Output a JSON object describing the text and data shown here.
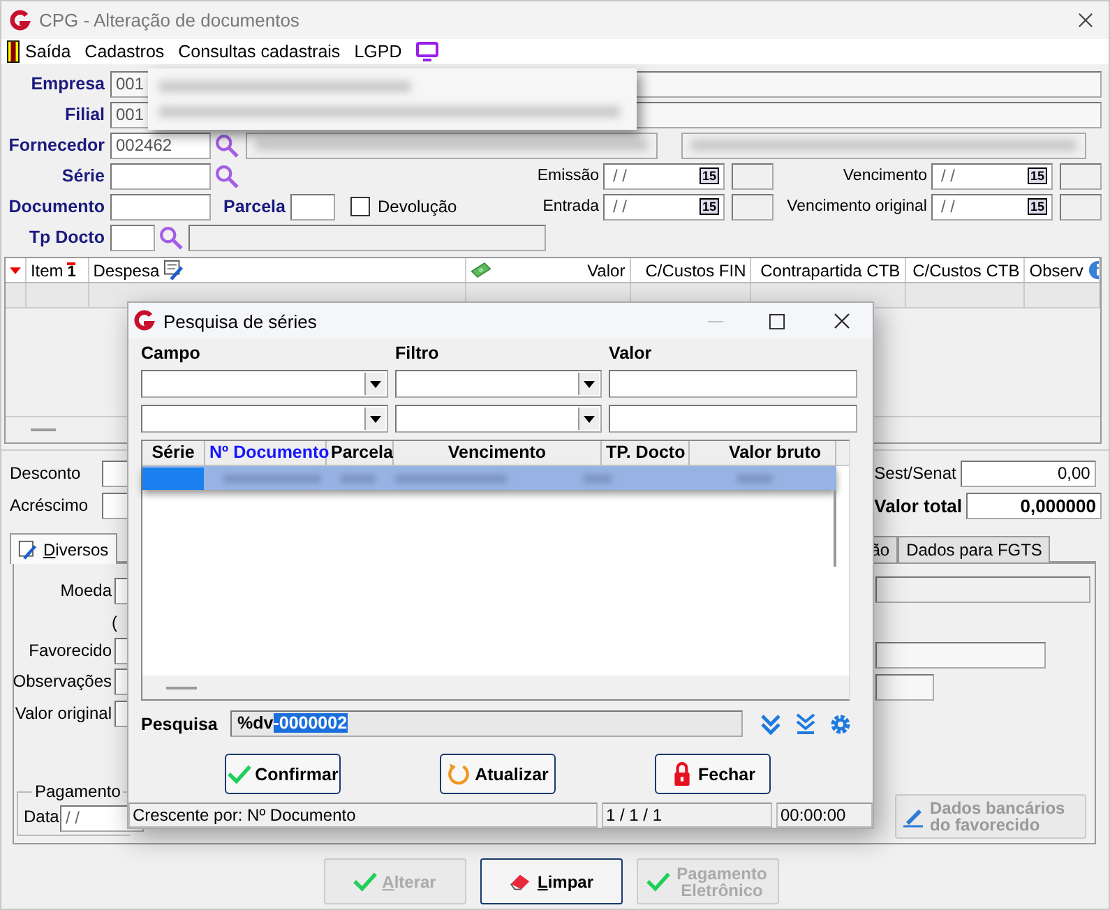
{
  "window": {
    "title": "CPG - Alteração de documentos"
  },
  "menu": [
    {
      "label": "Saída",
      "kind": "exit"
    },
    {
      "label": "Cadastros",
      "kind": "plain"
    },
    {
      "label": "Consultas cadastrais",
      "kind": "plain"
    },
    {
      "label": "LGPD",
      "kind": "plain"
    }
  ],
  "form": {
    "empresa": {
      "label": "Empresa",
      "value": "001"
    },
    "filial": {
      "label": "Filial",
      "value": "001"
    },
    "fornecedor": {
      "label": "Fornecedor",
      "value": "002462"
    },
    "serie": {
      "label": "Série"
    },
    "documento": {
      "label": "Documento"
    },
    "parcela": {
      "label": "Parcela"
    },
    "devolucao": {
      "label": "Devolução",
      "checked": false
    },
    "tp_docto": {
      "label": "Tp Docto"
    },
    "dates": [
      {
        "label": "Emissão",
        "value": "/ /",
        "calendar": "15"
      },
      {
        "label": "Vencimento",
        "value": "/ /",
        "calendar": "15"
      },
      {
        "label": "Entrada",
        "value": "/ /",
        "calendar": "15"
      },
      {
        "label": "Vencimento original",
        "value": "/ /",
        "calendar": "15"
      }
    ]
  },
  "grid": {
    "columns": [
      {},
      {
        "label": "Item",
        "sort_rank": "1"
      },
      {
        "label": "Despesa"
      },
      {
        "label": "Valor"
      },
      {
        "label": "C/Custos FIN"
      },
      {
        "label": "Contrapartida CTB"
      },
      {
        "label": "C/Custos CTB"
      },
      {
        "label": "Observ"
      }
    ]
  },
  "totals_left": [
    {
      "label": "Desconto"
    },
    {
      "label": "Acréscimo"
    }
  ],
  "totals_right": [
    {
      "label": "Sest/Senat",
      "value": "0,00",
      "kind": "plain"
    },
    {
      "label": "Valor total",
      "value": "0,000000",
      "kind": "total"
    }
  ],
  "tabs": [
    {
      "label": "Diversos",
      "selected": true
    },
    {
      "label": "ão",
      "selected": false
    },
    {
      "label": "Dados para FGTS",
      "selected": false
    }
  ],
  "tab_panel": {
    "fields": [
      {
        "label": "Moeda"
      },
      {
        "label": "("
      },
      {
        "label": "Favorecido"
      },
      {
        "label": "Observações"
      },
      {
        "label": "Valor original"
      }
    ],
    "payment": {
      "legend": "Pagamento",
      "date_label": "Data",
      "date_value": "/ /"
    },
    "bank_button": {
      "label": "Dados bancários do favorecido",
      "disabled": true
    }
  },
  "footer_buttons": [
    {
      "label": "Alterar",
      "kind": "check",
      "disabled": true
    },
    {
      "label": "Limpar",
      "kind": "eraser",
      "disabled": false
    },
    {
      "label": "Pagamento Eletrônico",
      "kind": "check",
      "disabled": true
    }
  ],
  "dialog": {
    "title": "Pesquisa de séries",
    "filter_headers": [
      "Campo",
      "Filtro",
      "Valor"
    ],
    "columns": [
      {
        "label": "Série",
        "sorted": false
      },
      {
        "label": "Nº Documento",
        "sorted": true
      },
      {
        "label": "Parcela",
        "sorted": false
      },
      {
        "label": "Vencimento",
        "sorted": false
      },
      {
        "label": "TP. Docto",
        "sorted": false
      },
      {
        "label": "Valor bruto",
        "sorted": false
      }
    ],
    "rows": [
      {
        "selected": true
      }
    ],
    "search": {
      "label": "Pesquisa",
      "value": "%dv",
      "selected_text": "-0000002"
    },
    "buttons": [
      {
        "label": "Confirmar",
        "kind": "check"
      },
      {
        "label": "Atualizar",
        "kind": "refresh"
      },
      {
        "label": "Fechar",
        "kind": "lock"
      }
    ],
    "status": [
      "Crescente por: Nº Documento",
      "1 / 1 / 1",
      "00:00:00"
    ]
  }
}
